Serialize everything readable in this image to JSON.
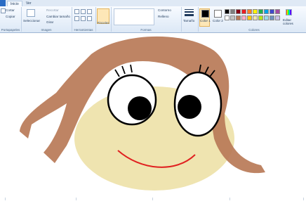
{
  "ribbon": {
    "tabs": [
      "Inicio",
      "Ver"
    ],
    "clipboard": {
      "cut": "Cortar",
      "copy": "Copiar",
      "label": "Portapapeles"
    },
    "image": {
      "select": "Seleccionar",
      "crop": "Recortar",
      "resize": "Cambiar tamaño",
      "rotate": "Girar",
      "label": "Imagen"
    },
    "tools": {
      "label": "Herramientas"
    },
    "brushes": {
      "label": "Pinceles"
    },
    "shapes": {
      "outline": "Contorno",
      "fill": "Relleno",
      "label": "Formas"
    },
    "size": {
      "label": "Tamaño"
    },
    "color1": {
      "label": "Color 1"
    },
    "color2": {
      "label": "Color 2"
    },
    "colors": {
      "label": "Colores",
      "edit_label": "Editar colores",
      "palette": [
        "#000000",
        "#7f7f7f",
        "#880015",
        "#ed1c24",
        "#ff7f27",
        "#fff200",
        "#22b14c",
        "#00a2e8",
        "#3f48cc",
        "#a349a4",
        "#ffffff",
        "#c3c3c3",
        "#b97a57",
        "#ffaec9",
        "#ffc90e",
        "#efe4b0",
        "#b5e61d",
        "#99d9ea",
        "#7092be",
        "#c8bfe7"
      ]
    }
  }
}
